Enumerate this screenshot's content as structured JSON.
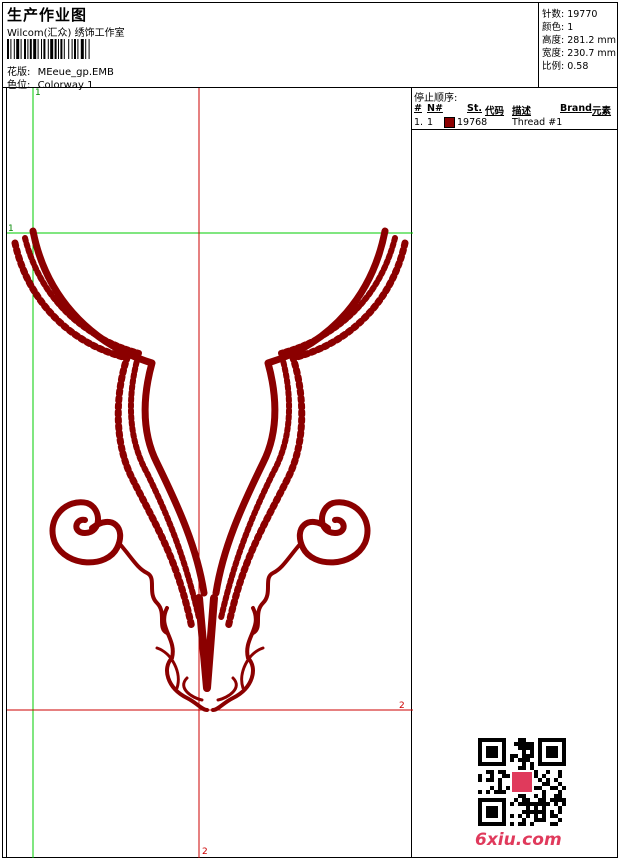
{
  "header": {
    "title": "生产作业图",
    "company": "Wilcom(汇众) 绣饰工作室",
    "design_label": "花版:",
    "design_value": "MEeue_gp.EMB",
    "colorway_label": "色位:",
    "colorway_value": "Colorway 1"
  },
  "stats": {
    "stitches": "针数: 19770",
    "colors": "颜色: 1",
    "height": "高度: 281.2 mm",
    "width": "宽度: 230.7 mm",
    "scale": "比例: 0.58"
  },
  "panel": {
    "heading": "停止顺序:",
    "columns": [
      "#",
      "N#",
      "St.",
      "代码",
      "描述",
      "Brand",
      "元素"
    ],
    "rows": [
      {
        "idx": "1.",
        "n": "1",
        "stitches": "19768",
        "desc": "Thread #1",
        "color": "#8b0000"
      }
    ]
  },
  "guides": {
    "green_v": "1",
    "green_h": "1",
    "red_h": "2",
    "red_v": "2"
  },
  "watermark": "6xiu.com",
  "colors": {
    "thread": "#8b0000",
    "guide_green": "#00cc00",
    "guide_red": "#cc0000"
  }
}
